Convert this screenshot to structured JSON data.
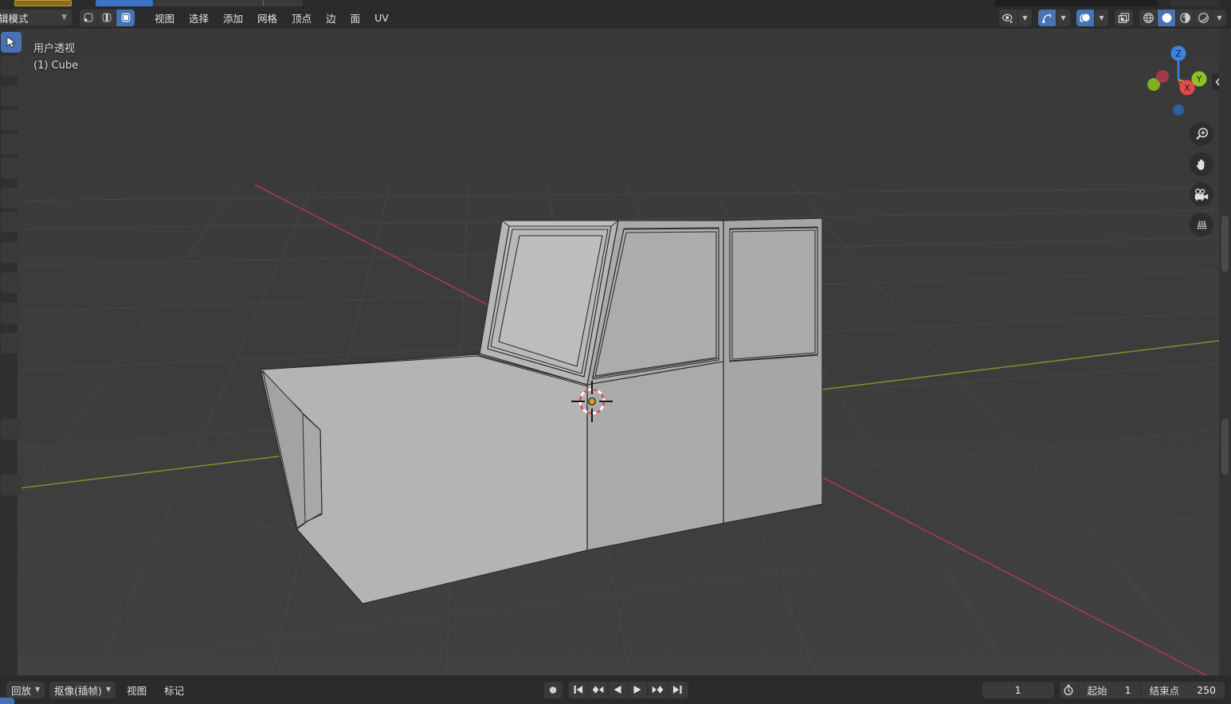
{
  "window": {
    "app": "Blender",
    "theme_bg": "#3b3b3b",
    "header_bg": "#2b2b2b",
    "accent": "#4772b3"
  },
  "header": {
    "mode_label": "辑模式",
    "mode_label_full": "编辑模式",
    "mode_chevron": "chevron-down-icon",
    "mesh_select_modes": [
      {
        "name": "vertex-select-mode",
        "icon": "vertex-select-icon",
        "active": false
      },
      {
        "name": "edge-select-mode",
        "icon": "edge-select-icon",
        "active": false
      },
      {
        "name": "face-select-mode",
        "icon": "face-select-icon",
        "active": true
      }
    ],
    "menus": [
      {
        "label": "视图"
      },
      {
        "label": "选择"
      },
      {
        "label": "添加"
      },
      {
        "label": "网格"
      },
      {
        "label": "顶点"
      },
      {
        "label": "边"
      },
      {
        "label": "面"
      },
      {
        "label": "UV"
      }
    ],
    "right_tools": [
      {
        "name": "visibility-selectability-toggle",
        "icon": "eye-cursor-icon",
        "active": false,
        "chevron": true
      },
      {
        "name": "snapping-toggle",
        "icon": "magnet-snap-icon",
        "active": true,
        "chevron": true
      },
      {
        "name": "proportional-editing-toggle",
        "icon": "proportional-edit-icon",
        "active": true,
        "chevron": true
      },
      {
        "name": "xray-toggle",
        "icon": "xray-icon",
        "active": false,
        "chevron": false
      }
    ],
    "shading_modes": [
      {
        "name": "shading-wireframe",
        "icon": "wireframe-icon",
        "active": false
      },
      {
        "name": "shading-solid",
        "icon": "solid-sphere-icon",
        "active": true
      },
      {
        "name": "shading-material",
        "icon": "material-preview-icon",
        "active": false
      },
      {
        "name": "shading-rendered",
        "icon": "rendered-icon",
        "active": false
      }
    ],
    "shading_chevron": "chevron-down-icon"
  },
  "viewport": {
    "overlay_line1": "用户透视",
    "overlay_line2": "(1) Cube",
    "object_name": "Cube",
    "grid_color": "#4a4a4a",
    "axis_x_color": "#cc4a5e",
    "axis_y_color": "#8a8a3a",
    "mesh_fill": "#a9a9a9",
    "mesh_edge": "#2c2c2c",
    "cursor_name": "3d-cursor"
  },
  "gizmo": {
    "axes": [
      {
        "label": "Z",
        "color": "#3b83e0",
        "name": "gizmo-axis-z-positive"
      },
      {
        "label": "Y",
        "color": "#94c024",
        "name": "gizmo-axis-y-positive"
      },
      {
        "label": "X",
        "color": "#e04a4a",
        "name": "gizmo-axis-x-positive"
      },
      {
        "label": "",
        "color": "#2a5ba0",
        "name": "gizmo-axis-z-negative"
      },
      {
        "label": "",
        "color": "#5a7a18",
        "name": "gizmo-axis-y-negative"
      },
      {
        "label": "",
        "color": "#9c3333",
        "name": "gizmo-axis-x-negative"
      }
    ]
  },
  "nav_buttons": [
    {
      "name": "zoom-view-icon",
      "label": "zoom"
    },
    {
      "name": "pan-view-icon",
      "label": "pan"
    },
    {
      "name": "camera-view-icon",
      "label": "camera"
    },
    {
      "name": "toggle-orthographic-icon",
      "label": "perspective/ortho"
    }
  ],
  "sidebar_toggle": {
    "name": "open-sidebar-chevron-icon",
    "direction": "left"
  },
  "toolbar": {
    "items": [
      {
        "name": "tool-tweak-select",
        "active": true
      },
      {
        "name": "tool-cursor",
        "active": false
      },
      {
        "name": "tool-move",
        "active": false
      },
      {
        "name": "tool-rotate",
        "active": false
      },
      {
        "name": "tool-scale",
        "active": false
      },
      {
        "name": "tool-transform",
        "active": false
      },
      {
        "name": "tool-annotate",
        "active": false
      },
      {
        "name": "tool-measure",
        "active": false
      },
      {
        "name": "tool-extrude",
        "active": false
      },
      {
        "name": "tool-inset-faces",
        "active": false
      },
      {
        "name": "tool-bevel",
        "active": false
      },
      {
        "name": "tool-loop-cut",
        "active": false
      },
      {
        "name": "tool-knife",
        "active": false
      }
    ]
  },
  "timeline": {
    "left_menus": [
      {
        "label": "回放",
        "has_chevron": true,
        "name": "playback-menu"
      },
      {
        "label": "抠像(插帧)",
        "has_chevron": true,
        "name": "keying-menu"
      },
      {
        "label": "视图",
        "has_chevron": false,
        "name": "view-menu"
      },
      {
        "label": "标记",
        "has_chevron": false,
        "name": "marker-menu"
      }
    ],
    "record_button": {
      "name": "auto-keying-record-button",
      "icon": "record-circle-icon"
    },
    "transport": [
      {
        "name": "jump-to-start-button",
        "icon": "skip-start-icon"
      },
      {
        "name": "previous-keyframe-button",
        "icon": "prev-keyframe-icon"
      },
      {
        "name": "play-reverse-button",
        "icon": "play-reverse-icon"
      },
      {
        "name": "play-button",
        "icon": "play-icon"
      },
      {
        "name": "next-keyframe-button",
        "icon": "next-keyframe-icon"
      },
      {
        "name": "jump-to-end-button",
        "icon": "skip-end-icon"
      }
    ],
    "current_frame": "1",
    "use_preview_range_icon": "stopwatch-icon",
    "start_label": "起始",
    "start_value": "1",
    "end_label": "结束点",
    "end_value": "250"
  }
}
